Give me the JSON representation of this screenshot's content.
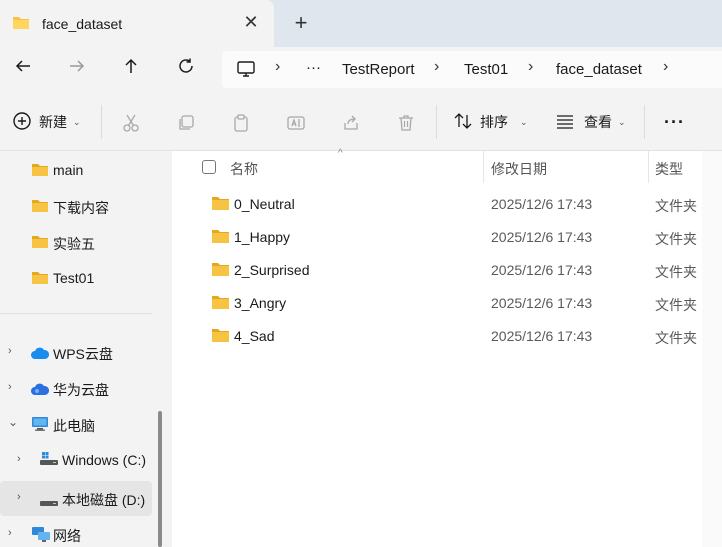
{
  "tab": {
    "title": "face_dataset",
    "close_glyph": "✕",
    "new_glyph": "+"
  },
  "breadcrumb": {
    "more": "···",
    "items": [
      "TestReport",
      "Test01",
      "face_dataset"
    ]
  },
  "toolbar": {
    "new_label": "新建",
    "sort_label": "排序",
    "view_label": "查看",
    "more_glyph": "···"
  },
  "sidebar": {
    "quick": [
      "main",
      "下载内容",
      "实验五",
      "Test01"
    ],
    "groups": [
      {
        "label": "WPS云盘",
        "icon": "cloud-icon",
        "color": "#1a8cf0"
      },
      {
        "label": "华为云盘",
        "icon": "cloud-icon",
        "color": "#2b6fe0"
      },
      {
        "label": "此电脑",
        "icon": "monitor-icon",
        "expanded": true
      },
      {
        "label": "Windows (C:)",
        "icon": "drive-icon"
      },
      {
        "label": "本地磁盘 (D:)",
        "icon": "drive-icon",
        "selected": true
      },
      {
        "label": "网络",
        "icon": "network-icon"
      }
    ]
  },
  "columns": {
    "name": "名称",
    "date": "修改日期",
    "type": "类型"
  },
  "files": [
    {
      "name": "0_Neutral",
      "date": "2025/12/6 17:43",
      "type": "文件夹"
    },
    {
      "name": "1_Happy",
      "date": "2025/12/6 17:43",
      "type": "文件夹"
    },
    {
      "name": "2_Surprised",
      "date": "2025/12/6 17:43",
      "type": "文件夹"
    },
    {
      "name": "3_Angry",
      "date": "2025/12/6 17:43",
      "type": "文件夹"
    },
    {
      "name": "4_Sad",
      "date": "2025/12/6 17:43",
      "type": "文件夹"
    }
  ],
  "colors": {
    "folder": "#f6c342",
    "folder_dark": "#e4a820",
    "accent": "#0067c0"
  }
}
